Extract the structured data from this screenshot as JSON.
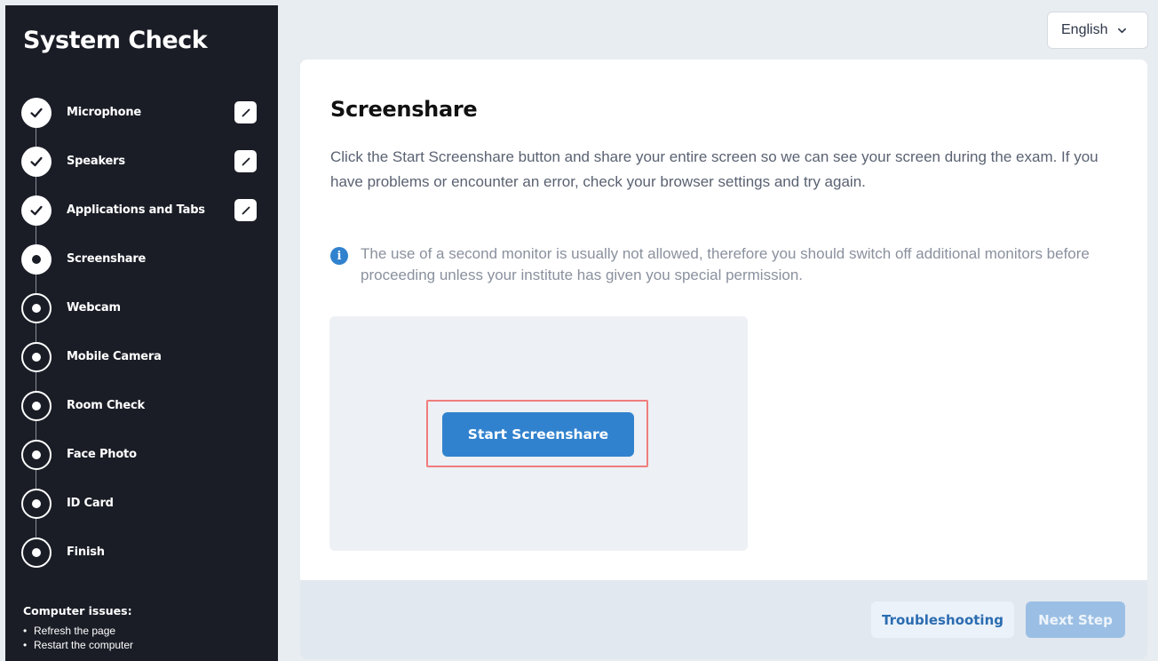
{
  "sidebar": {
    "title": "System Check",
    "steps": [
      {
        "label": "Microphone",
        "status": "done",
        "editable": true
      },
      {
        "label": "Speakers",
        "status": "done",
        "editable": true
      },
      {
        "label": "Applications and Tabs",
        "status": "done",
        "editable": true
      },
      {
        "label": "Screenshare",
        "status": "current",
        "editable": false
      },
      {
        "label": "Webcam",
        "status": "pending",
        "editable": false
      },
      {
        "label": "Mobile Camera",
        "status": "pending",
        "editable": false
      },
      {
        "label": "Room Check",
        "status": "pending",
        "editable": false
      },
      {
        "label": "Face Photo",
        "status": "pending",
        "editable": false
      },
      {
        "label": "ID Card",
        "status": "pending",
        "editable": false
      },
      {
        "label": "Finish",
        "status": "pending",
        "editable": false
      }
    ],
    "issues": {
      "title": "Computer issues:",
      "items": [
        "Refresh the page",
        "Restart the computer"
      ]
    }
  },
  "language": {
    "selected": "English"
  },
  "main": {
    "title": "Screenshare",
    "description": "Click the Start Screenshare button and share your entire screen so we can see your screen during the exam. If you have problems or encounter an error, check your browser settings and try again.",
    "info": "The use of a second monitor is usually not allowed, therefore you should switch off additional monitors before proceeding unless your institute has given you special permission.",
    "start_button": "Start Screenshare"
  },
  "footer": {
    "troubleshooting": "Troubleshooting",
    "next_step": "Next Step"
  },
  "colors": {
    "sidebar_bg": "#1a1d26",
    "primary": "#3182ce",
    "highlight": "#f07d7d",
    "page_bg": "#e8edf2"
  }
}
